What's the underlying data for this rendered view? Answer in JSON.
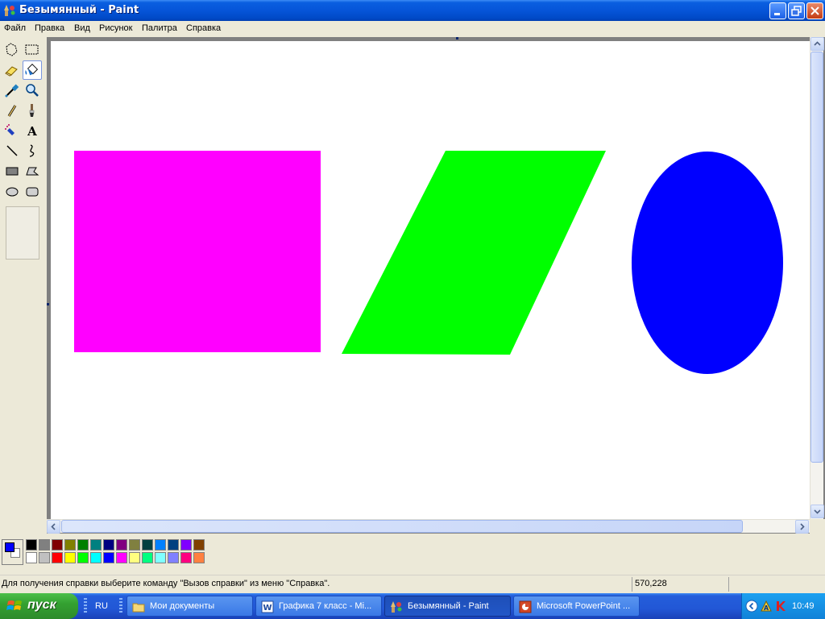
{
  "window": {
    "title": "Безымянный - Paint",
    "icon": "paint-brush-icon"
  },
  "menu": [
    "Файл",
    "Правка",
    "Вид",
    "Рисунок",
    "Палитра",
    "Справка"
  ],
  "tools": [
    {
      "name": "free-select",
      "icon": "free-select-icon"
    },
    {
      "name": "rect-select",
      "icon": "rect-select-icon"
    },
    {
      "name": "eraser",
      "icon": "eraser-icon"
    },
    {
      "name": "fill",
      "icon": "fill-bucket-icon",
      "active": true
    },
    {
      "name": "color-picker",
      "icon": "eyedropper-icon"
    },
    {
      "name": "magnifier",
      "icon": "magnifier-icon"
    },
    {
      "name": "pencil",
      "icon": "pencil-icon"
    },
    {
      "name": "brush",
      "icon": "brush-icon"
    },
    {
      "name": "airbrush",
      "icon": "airbrush-icon"
    },
    {
      "name": "text",
      "icon": "text-icon",
      "glyph": "A"
    },
    {
      "name": "line",
      "icon": "line-icon"
    },
    {
      "name": "curve",
      "icon": "curve-icon"
    },
    {
      "name": "rectangle",
      "icon": "rectangle-icon"
    },
    {
      "name": "polygon",
      "icon": "polygon-icon"
    },
    {
      "name": "ellipse",
      "icon": "ellipse-icon"
    },
    {
      "name": "rounded-rect",
      "icon": "rounded-rect-icon"
    }
  ],
  "canvas": {
    "background": "#ffffff",
    "shapes": [
      {
        "kind": "rectangle",
        "fill": "#ff00ff"
      },
      {
        "kind": "parallelogram",
        "fill": "#00ff00"
      },
      {
        "kind": "ellipse",
        "fill": "#0000ff"
      }
    ]
  },
  "palette": {
    "foreground": "#0000ff",
    "background": "#ffffff",
    "colors": [
      "#000000",
      "#808080",
      "#800000",
      "#808000",
      "#008000",
      "#008080",
      "#000080",
      "#800080",
      "#808040",
      "#004040",
      "#0080ff",
      "#004080",
      "#8000ff",
      "#804000",
      "#ffffff",
      "#c0c0c0",
      "#ff0000",
      "#ffff00",
      "#00ff00",
      "#00ffff",
      "#0000ff",
      "#ff00ff",
      "#ffff80",
      "#00ff80",
      "#80ffff",
      "#8080ff",
      "#ff0080",
      "#ff8040"
    ]
  },
  "status": {
    "hint": "Для получения справки выберите команду \"Вызов справки\" из меню \"Справка\".",
    "coords": "570,228"
  },
  "taskbar": {
    "start_label": "пуск",
    "language": "RU",
    "tasks": [
      {
        "label": "Мои документы",
        "icon": "folder-icon"
      },
      {
        "label": "Графика 7 класс - Mi...",
        "icon": "word-icon"
      },
      {
        "label": "Безымянный - Paint",
        "icon": "paint-brush-icon",
        "active": true
      },
      {
        "label": "Microsoft PowerPoint ...",
        "icon": "powerpoint-icon"
      }
    ],
    "clock": "10:49"
  }
}
